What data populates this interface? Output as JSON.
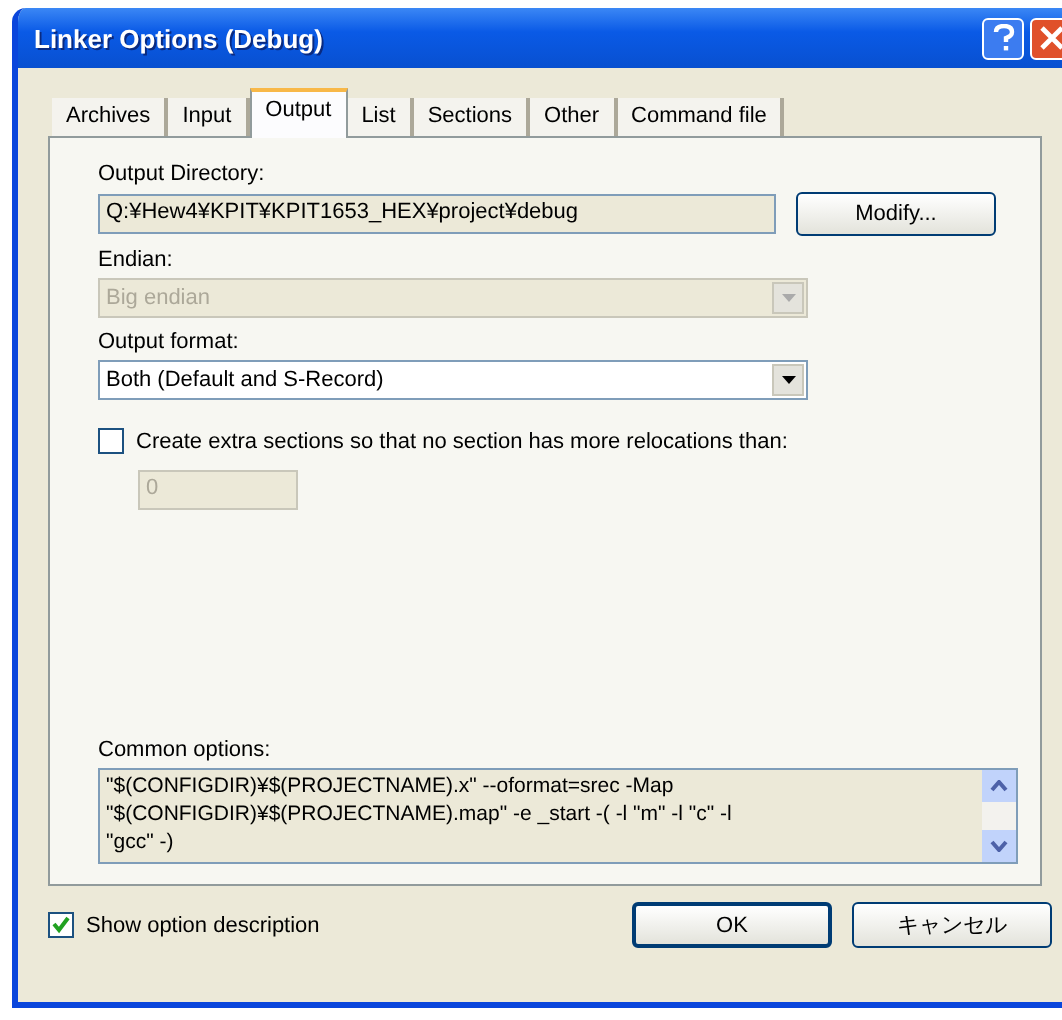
{
  "window": {
    "title": "Linker Options (Debug)"
  },
  "tabs": [
    {
      "label": "Archives",
      "selected": false
    },
    {
      "label": "Input",
      "selected": false
    },
    {
      "label": "Output",
      "selected": true
    },
    {
      "label": "List",
      "selected": false
    },
    {
      "label": "Sections",
      "selected": false
    },
    {
      "label": "Other",
      "selected": false
    },
    {
      "label": "Command file",
      "selected": false
    }
  ],
  "output_directory": {
    "label": "Output Directory:",
    "value": "Q:¥Hew4¥KPIT¥KPIT1653_HEX¥project¥debug",
    "button": "Modify..."
  },
  "endian": {
    "label": "Endian:",
    "value": "Big endian",
    "disabled": true
  },
  "output_format": {
    "label": "Output format:",
    "value": "Both (Default and S-Record)",
    "disabled": false
  },
  "extra_sections": {
    "label": "Create extra sections so that no section has more relocations than:",
    "checked": false,
    "value": "0",
    "disabled": true
  },
  "common_options": {
    "label": "Common options:",
    "value": "\"$(CONFIGDIR)¥$(PROJECTNAME).x\" --oformat=srec -Map\n\"$(CONFIGDIR)¥$(PROJECTNAME).map\" -e _start -( -l \"m\" -l \"c\" -l\n\"gcc\" -)"
  },
  "show_description": {
    "label": "Show option description",
    "checked": true
  },
  "buttons": [
    "OK",
    "キャンセル"
  ]
}
